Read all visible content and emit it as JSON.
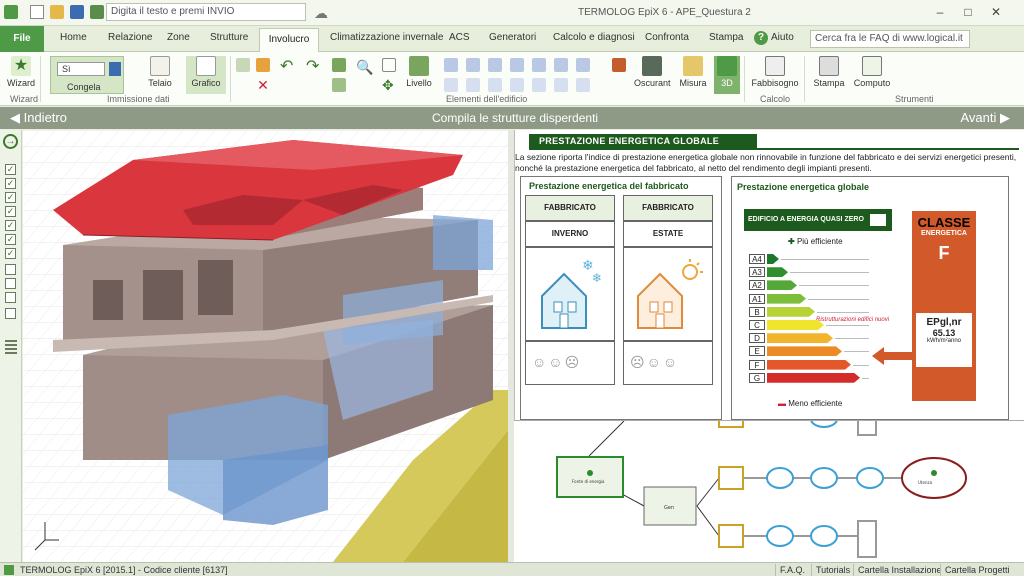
{
  "titlebar": {
    "search_placeholder": "Digita il testo e premi INVIO",
    "app_title": "TERMOLOG EpiX 6 - APE_Questura 2",
    "min": "–",
    "max": "□",
    "close": "✕"
  },
  "tabs": {
    "file": "File",
    "items": [
      "Home",
      "Relazione",
      "Zone",
      "Strutture",
      "Involucro",
      "Climatizzazione invernale",
      "ACS",
      "Generatori",
      "Calcolo e diagnosi",
      "Confronta",
      "Stampa"
    ],
    "active": "Involucro",
    "help": "Aiuto",
    "faq_placeholder": "Cerca fra le FAQ di www.logical.it"
  },
  "ribbon": {
    "wizard": "Wizard",
    "toggle_si": "Sì",
    "congela": "Congela",
    "telaio": "Telaio",
    "grafico": "Grafico",
    "livello": "Livello",
    "oscuranti": "Oscurant",
    "misura": "Misura",
    "view3d": "3D",
    "fabbisogno": "Fabbisogno",
    "stampa": "Stampa",
    "computo": "Computo",
    "groups": {
      "wizard": "Wizard",
      "immissione": "Immissione dati",
      "elementi": "Elementi dell'edificio",
      "calcolo": "Calcolo",
      "strumenti": "Strumenti"
    }
  },
  "navbar": {
    "back": "◀ Indietro",
    "title": "Compila le strutture disperdenti",
    "next": "Avanti ▶"
  },
  "sidebar": {
    "checks": [
      "✓",
      "✓",
      "✓",
      "✓",
      "✓",
      "✓",
      "✓",
      "",
      "",
      "",
      ""
    ]
  },
  "panel": {
    "header": "PRESTAZIONE ENERGETICA GLOBALE",
    "desc": "La sezione riporta l'indice di prestazione energetica globale non rinnovabile in funzione del fabbricato e dei servizi energetici presenti, nonché la prestazione energetica del fabbricato, al netto del rendimento degli impianti presenti.",
    "fab_title": "Prestazione energetica del fabbricato",
    "fab_label": "FABBRICATO",
    "inverno": "INVERNO",
    "estate": "ESTATE",
    "glob_title": "Prestazione energetica globale",
    "nzeb": "EDIFICIO A ENERGIA QUASI ZERO",
    "piu": "Più efficiente",
    "meno": "Meno efficiente",
    "ref": "Ristrutturazioni edifici nuovi",
    "classe": "CLASSE",
    "energetica": "ENERGETICA",
    "class_value": "F",
    "ep": "EPgl,nr",
    "ep_value": "65.13",
    "ep_unit": "kWh/m²anno",
    "classes": [
      "A4",
      "A3",
      "A2",
      "A1",
      "B",
      "C",
      "D",
      "E",
      "F",
      "G"
    ],
    "class_colors": [
      "#1a7a2a",
      "#2f8f2f",
      "#55a838",
      "#7cbd3a",
      "#b6d236",
      "#f1e42f",
      "#f2b42a",
      "#ec8a26",
      "#e4572a",
      "#d42b2b"
    ]
  },
  "diagram": {
    "node1": "Fonte di energia",
    "node2": "Gen",
    "node3": "Utenza"
  },
  "status": {
    "left": "TERMOLOG EpiX 6 [2015.1] - Codice cliente [6137]",
    "faq": "F.A.Q.",
    "tutorials": "Tutorials",
    "cartella_inst": "Cartella Installazione",
    "cartella_prog": "Cartella Progetti"
  },
  "colors": {
    "accent": "#4f9a46",
    "roof": "#d9363e",
    "wall": "#a4918c",
    "glass": "#7ea6d8",
    "banner": "#1d5a1d"
  }
}
